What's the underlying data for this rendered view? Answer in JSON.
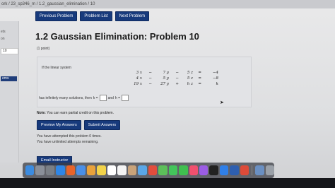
{
  "browser": {
    "url": "ork / 23_sp346_m / 1.2_gaussian_elimination / 10"
  },
  "nav": {
    "previous": "Previous Problem",
    "list": "Problem List",
    "next": "Next Problem"
  },
  "sidebar": {
    "items": [
      "ets",
      "on",
      "10",
      "ems"
    ]
  },
  "problem": {
    "title": "1.2 Gaussian Elimination: Problem 10",
    "points": "(1 point)",
    "intro": "If the linear system",
    "equations": [
      [
        "3 x",
        "−",
        "7 y",
        "−",
        "5 z",
        "=",
        "−4"
      ],
      [
        "4 x",
        "−",
        "5 y",
        "−",
        "5 z",
        "=",
        "−8"
      ],
      [
        "19 x",
        "−",
        "27 y",
        "+",
        "h z",
        "=",
        "k"
      ]
    ],
    "sentence_start": "has infinitely many solutions, then",
    "k_label": "k =",
    "and": "and",
    "h_label": "h ="
  },
  "note": {
    "label": "Note:",
    "text": "You can earn partial credit on this problem."
  },
  "actions": {
    "preview": "Preview My Answers",
    "submit": "Submit Answers"
  },
  "status": {
    "attempts": "You have attempted this problem 0 times.",
    "unlimited": "You have unlimited attempts remaining."
  },
  "email": "Email Instructor",
  "dock": {
    "icons": [
      {
        "name": "finder-icon",
        "color": "#3b8be0"
      },
      {
        "name": "launchpad-icon",
        "color": "#8a8f99"
      },
      {
        "name": "system-settings-icon",
        "color": "#7a7f86"
      },
      {
        "name": "safari-icon",
        "color": "#2f86e6"
      },
      {
        "name": "firefox-icon",
        "color": "#e8642a"
      },
      {
        "name": "mail-icon",
        "color": "#4a8fe7"
      },
      {
        "name": "photos-icon",
        "color": "#e9a23b"
      },
      {
        "name": "notes-icon",
        "color": "#f2d34a"
      },
      {
        "name": "calendar-icon",
        "color": "#ffffff"
      },
      {
        "name": "reminders-icon",
        "color": "#f4f4f4"
      },
      {
        "name": "contacts-icon",
        "color": "#c9a37a"
      },
      {
        "name": "preview-icon",
        "color": "#5aa7e8"
      },
      {
        "name": "chrome-icon",
        "color": "#e24d3d"
      },
      {
        "name": "maps-icon",
        "color": "#5cbf5a"
      },
      {
        "name": "messages-icon",
        "color": "#43c55b"
      },
      {
        "name": "facetime-icon",
        "color": "#3fbf4f"
      },
      {
        "name": "music-icon",
        "color": "#f0506e"
      },
      {
        "name": "podcasts-icon",
        "color": "#9b5de5"
      },
      {
        "name": "tv-icon",
        "color": "#222222"
      },
      {
        "name": "app-store-icon",
        "color": "#2f7fe8"
      },
      {
        "name": "vpn-icon",
        "color": "#2e5fb0"
      },
      {
        "name": "chrome-icon-2",
        "color": "#dd4b39"
      },
      {
        "name": "downloads-icon",
        "color": "#6a8fc2"
      },
      {
        "name": "trash-icon",
        "color": "#9aa0a8"
      }
    ]
  }
}
